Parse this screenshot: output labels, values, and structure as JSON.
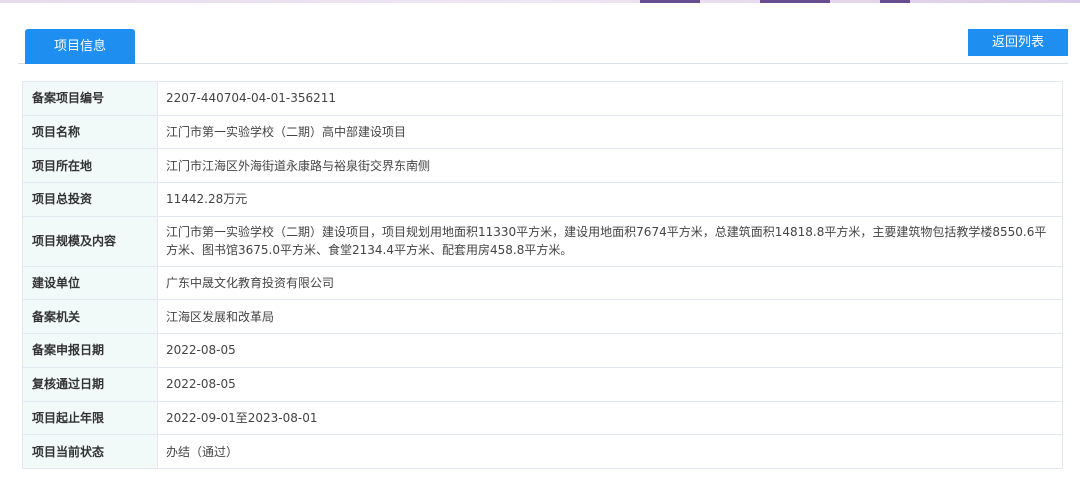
{
  "header": {
    "tab_label": "项目信息",
    "back_label": "返回列表"
  },
  "colors": {
    "accent": "#1f8ef1",
    "label_bg": "#f1faf9",
    "border": "#e3e8ee"
  },
  "rows": [
    {
      "label": "备案项目编号",
      "value": "2207-440704-04-01-356211"
    },
    {
      "label": "项目名称",
      "value": "江门市第一实验学校（二期）高中部建设项目"
    },
    {
      "label": "项目所在地",
      "value": "江门市江海区外海街道永康路与裕泉街交界东南侧"
    },
    {
      "label": "项目总投资",
      "value": "11442.28万元"
    },
    {
      "label": "项目规模及内容",
      "value": "江门市第一实验学校（二期）建设项目，项目规划用地面积11330平方米，建设用地面积7674平方米，总建筑面积14818.8平方米，主要建筑物包括教学楼8550.6平方米、图书馆3675.0平方米、食堂2134.4平方米、配套用房458.8平方米。"
    },
    {
      "label": "建设单位",
      "value": "广东中晟文化教育投资有限公司"
    },
    {
      "label": "备案机关",
      "value": "江海区发展和改革局"
    },
    {
      "label": "备案申报日期",
      "value": "2022-08-05"
    },
    {
      "label": "复核通过日期",
      "value": "2022-08-05"
    },
    {
      "label": "项目起止年限",
      "value": "2022-09-01至2023-08-01"
    },
    {
      "label": "项目当前状态",
      "value": "办结（通过）"
    }
  ]
}
